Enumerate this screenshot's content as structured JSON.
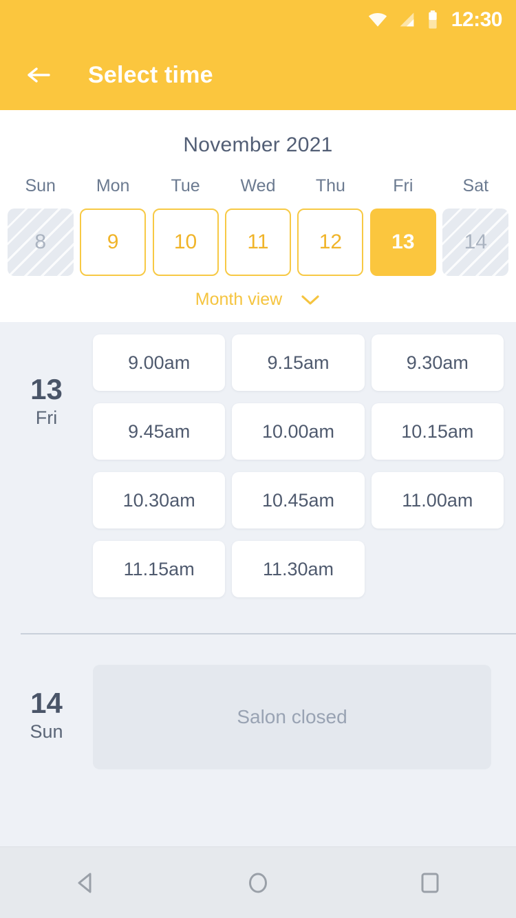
{
  "status_bar": {
    "time": "12:30",
    "icons": [
      "wifi-icon",
      "signal-icon",
      "battery-icon"
    ]
  },
  "app_bar": {
    "back_icon": "arrow-left-icon",
    "title": "Select time"
  },
  "calendar": {
    "month_year": "November 2021",
    "day_headers": [
      "Sun",
      "Mon",
      "Tue",
      "Wed",
      "Thu",
      "Fri",
      "Sat"
    ],
    "days": [
      {
        "number": "8",
        "state": "disabled"
      },
      {
        "number": "9",
        "state": "available"
      },
      {
        "number": "10",
        "state": "available"
      },
      {
        "number": "11",
        "state": "available"
      },
      {
        "number": "12",
        "state": "available"
      },
      {
        "number": "13",
        "state": "selected"
      },
      {
        "number": "14",
        "state": "disabled"
      }
    ],
    "month_view_label": "Month view",
    "month_view_icon": "chevron-down-icon"
  },
  "schedule": [
    {
      "day_number": "13",
      "day_name": "Fri",
      "slots": [
        "9.00am",
        "9.15am",
        "9.30am",
        "9.45am",
        "10.00am",
        "10.15am",
        "10.30am",
        "10.45am",
        "11.00am",
        "11.15am",
        "11.30am"
      ]
    },
    {
      "day_number": "14",
      "day_name": "Sun",
      "closed_label": "Salon closed"
    }
  ],
  "nav_bar": {
    "back_icon": "triangle-back-icon",
    "home_icon": "circle-home-icon",
    "recents_icon": "square-recents-icon"
  },
  "colors": {
    "accent": "#fbc63e",
    "accent_border": "#f7c944",
    "page_bg": "#eef1f6",
    "card_bg": "#ffffff",
    "text_dark": "#4a5568",
    "text_muted": "#99a3b3",
    "disabled_bg": "#e6eaf0"
  }
}
